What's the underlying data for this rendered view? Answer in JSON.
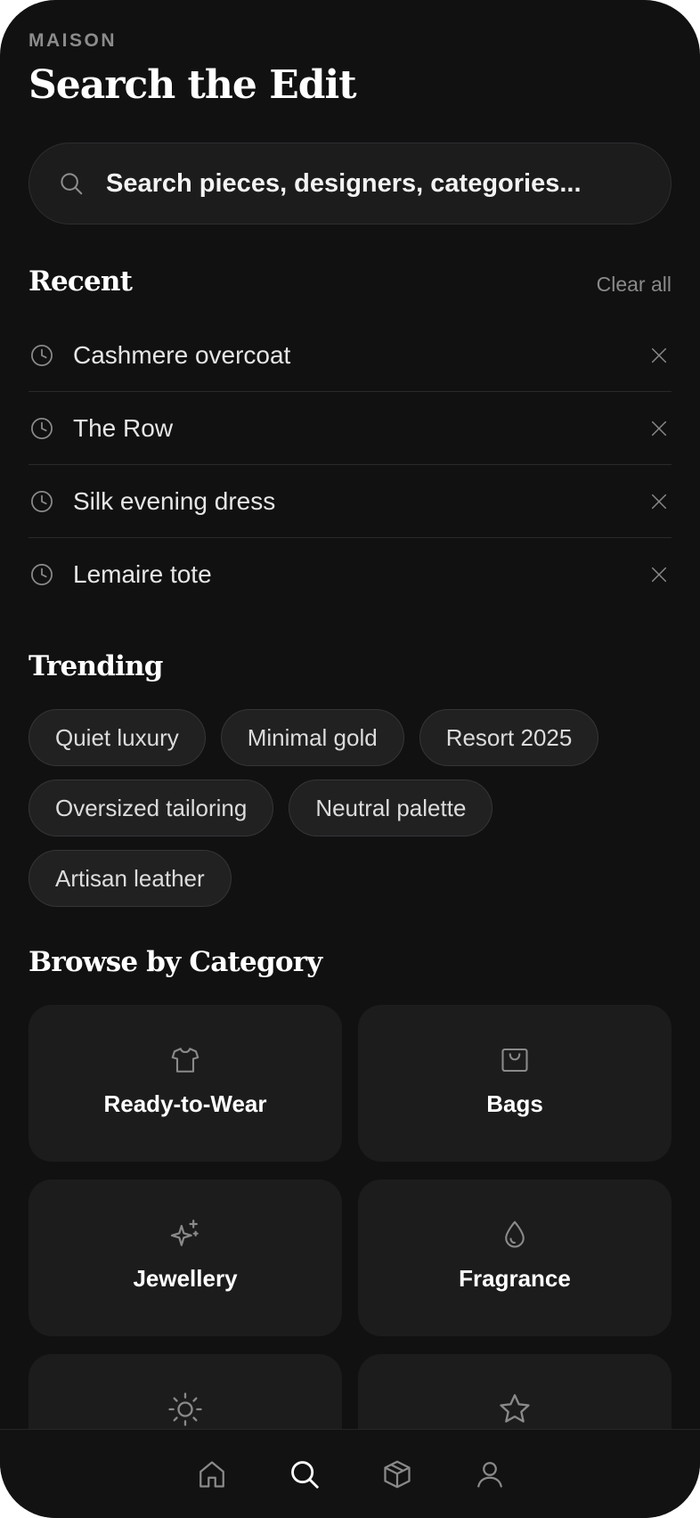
{
  "header": {
    "brand": "MAISON",
    "title": "Search the Edit"
  },
  "search": {
    "placeholder": "Search pieces, designers, categories..."
  },
  "recent": {
    "title": "Recent",
    "clear_label": "Clear all",
    "items": [
      {
        "label": "Cashmere overcoat"
      },
      {
        "label": "The Row"
      },
      {
        "label": "Silk evening dress"
      },
      {
        "label": "Lemaire tote"
      }
    ]
  },
  "trending": {
    "title": "Trending",
    "chips": [
      "Quiet luxury",
      "Minimal gold",
      "Resort 2025",
      "Oversized tailoring",
      "Neutral palette",
      "Artisan leather"
    ]
  },
  "categories": {
    "title": "Browse by Category",
    "items": [
      {
        "label": "Ready-to-Wear",
        "icon": "tshirt-icon"
      },
      {
        "label": "Bags",
        "icon": "bag-icon"
      },
      {
        "label": "Jewellery",
        "icon": "sparkle-icon"
      },
      {
        "label": "Fragrance",
        "icon": "drop-icon"
      },
      {
        "label": "",
        "icon": "sun-icon"
      },
      {
        "label": "",
        "icon": "star-icon"
      }
    ]
  },
  "tabbar": {
    "items": [
      {
        "icon": "home-icon",
        "active": false
      },
      {
        "icon": "search-icon",
        "active": true
      },
      {
        "icon": "box-icon",
        "active": false
      },
      {
        "icon": "profile-icon",
        "active": false
      }
    ]
  },
  "colors": {
    "background": "#111112",
    "surface": "#1c1c1d",
    "text": "#ffffff",
    "muted": "#8a8a8a"
  }
}
